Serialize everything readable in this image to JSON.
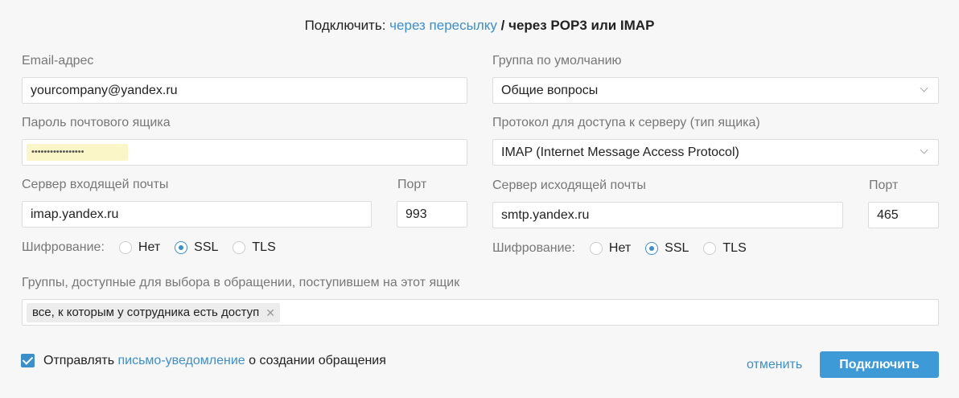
{
  "header": {
    "prefix": "Подключить:",
    "link_forward": "через пересылку",
    "separator": "/",
    "current": "через POP3 или IMAP"
  },
  "email": {
    "label": "Email-адрес",
    "value": "yourcompany@yandex.ru"
  },
  "password": {
    "label": "Пароль почтового ящика",
    "value": "•••••••••••••••••"
  },
  "default_group": {
    "label": "Группа по умолчанию",
    "value": "Общие вопросы"
  },
  "protocol": {
    "label": "Протокол для доступа к серверу (тип ящика)",
    "value": "IMAP (Internet Message Access Protocol)"
  },
  "incoming": {
    "server_label": "Сервер входящей почты",
    "server_value": "imap.yandex.ru",
    "port_label": "Порт",
    "port_value": "993",
    "enc_label": "Шифрование:",
    "options": [
      "Нет",
      "SSL",
      "TLS"
    ],
    "selected": "SSL"
  },
  "outgoing": {
    "server_label": "Сервер исходящей почты",
    "server_value": "smtp.yandex.ru",
    "port_label": "Порт",
    "port_value": "465",
    "enc_label": "Шифрование:",
    "options": [
      "Нет",
      "SSL",
      "TLS"
    ],
    "selected": "SSL"
  },
  "groups": {
    "label": "Группы, доступные для выбора в обращении, поступившем на этот ящик",
    "tag": "все, к которым у сотрудника есть доступ",
    "tag_remove": "✕"
  },
  "notify": {
    "checked": true,
    "prefix": "Отправлять",
    "link": "письмо-уведомление",
    "suffix": "о создании обращения"
  },
  "actions": {
    "cancel": "отменить",
    "submit": "Подключить"
  },
  "colors": {
    "accent": "#3d8fc9",
    "button": "#3d9ad6",
    "autofill": "#fbf6c8"
  }
}
